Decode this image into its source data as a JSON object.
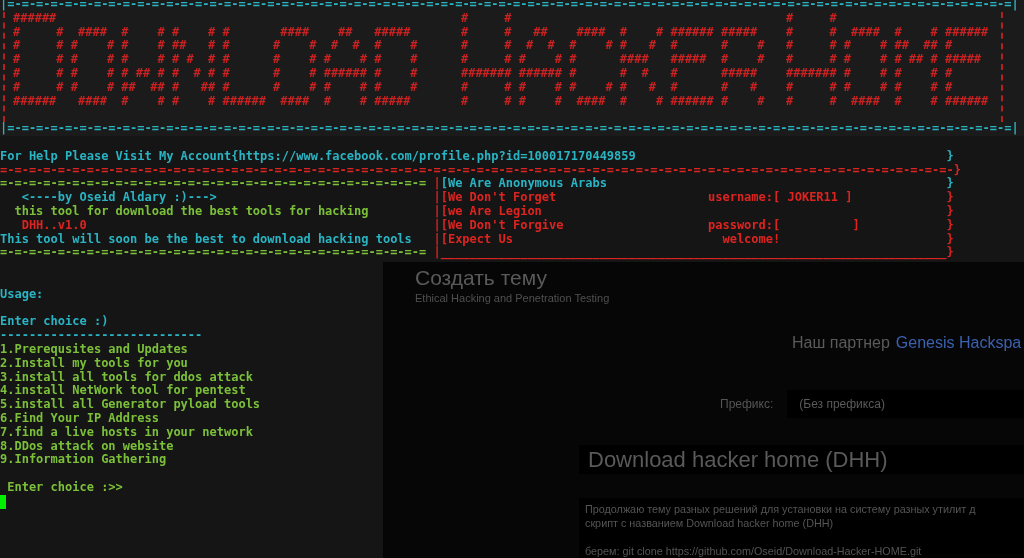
{
  "terminal": {
    "banner": {
      "border_top": "|=-=-=-=-=-=-=-=-=-=-=-=-=-=-=-=-=-=-=-=-=-=-=-=-=-=-=-=-=-=-=-=-=-=-=-=-=-=-=-=-=-=-=-=-=-=-=-=-=-=-=-=-=-=-=-=-=-=-=-=-=-=-=-=-=-=-=-=-=-=|",
      "rows": [
        "######                                                        #     #                                      #     #",
        "#     #  ####  #    # #    # #       ####    ##   #####       #     #   ##    ####  #    # ###### #####    #     #  ####  #    # ######",
        "#     # #    # #    # ##   # #      #    #  #  #  #    #      #     #  #  #  #    # #   #  #      #    #   #     # #    # ##  ## #",
        "#     # #    # #    # # #  # #      #    # #    # #    #      #     # #    # #      ####   #####  #    #   #     # #    # # ## # #####",
        "#     # #    # # ## # #  # # #      #    # ###### #    #      ####### ###### #      #  #   #      #####    ####### #    # #    # #",
        "#     # #    # ##  ## #   ## #      #    # #    # #    #      #     # #    # #    # #   #  #      #   #    #     # #    # #    # #",
        "######   ####  #    # #    # ######  ####  #    # #####       #     # #    #  ####  #    # ###### #    #   #     #  ####  #    # ######"
      ],
      "border_bottom": "|=-=-=-=-=-=-=-=-=-=-=-=-=-=-=-=-=-=-=-=-=-=-=-=-=-=-=-=-=-=-=-=-=-=-=-=-=-=-=-=-=-=-=-=-=-=-=-=-=-=-=-=-=-=-=-=-=-=-=-=-=-=-=-=-=-=-=-=-=-=|"
    },
    "help": {
      "text": "For Help Please Visit My Account{https://www.facebook.com/profile.php?id=100017170449859",
      "end": "}"
    },
    "rule_red": "=-=-=-=-=-=-=-=-=-=-=-=-=-=-=-=-=-=-=-=-=-=-=-=-=-=-=-=-=-=-=-=-=-=-=-=-=-=-=-=-=-=-=-=-=-=-=-=-=-=-=-=-=-=-=-=-=-=-=-=-=-=-=-=-=-=-}",
    "intro": {
      "rule_top": "=-=-=-=-=-=-=-=-=-=-=-=-=-=-=-=-=-=-=-=-=-=-=-=-=-=-=-=-=-=",
      "lines": [
        {
          "text": "   <----by Oseid Aldary :)--->",
          "color": "#2ab4c3"
        },
        {
          "text": "  this tool for download the best tools for hacking",
          "color": "#7cc03a"
        },
        {
          "text": "   DHH..v1.0",
          "color": "#dd2420"
        },
        {
          "text": "This tool will soon be the best to download hacking tools",
          "color": "#2ab4c3"
        }
      ],
      "rule_bottom": "=-=-=-=-=-=-=-=-=-=-=-=-=-=-=-=-=-=-=-=-=-=-=-=-=-=-=-=-=-="
    },
    "slogans": {
      "lines": [
        {
          "bar": "|",
          "text": "[We Are Anonymous Arabs",
          "color": "#2ab4c3",
          "end": "}"
        },
        {
          "bar": "|",
          "text": "[We Don't Forget",
          "field": "username:[ JOKER11 ]",
          "color": "#dd2420",
          "end": "}"
        },
        {
          "bar": "|",
          "text": "[we Are Legion",
          "color": "#dd2420",
          "end": "}"
        },
        {
          "bar": "|",
          "text": "[We Don't Forgive",
          "field": "password:[          ]",
          "color": "#dd2420",
          "end": "}"
        },
        {
          "bar": "|",
          "text": "[Expect Us",
          "field": "  welcome!",
          "color": "#dd2420",
          "end": "}"
        }
      ],
      "footer": "|______________________________________________________________________}"
    },
    "usage": "Usage:",
    "prompt": "Enter choice :)",
    "divider": "----------------------------",
    "menu": [
      "1.Prerequsites and Updates",
      "2.Install my tools for you",
      "3.install all tools for ddos attack",
      "4.install NetWork tool for pentest",
      "5.install all Generator pyload tools",
      "6.Find Your IP Address",
      "7.find a live hosts in your network",
      "8.DDos attack on website",
      "9.Information Gathering"
    ],
    "input_prompt": " Enter choice :>>"
  },
  "browser": {
    "title": "Создать тему",
    "subtitle": "Ethical Hacking and Penetration Testing",
    "partner_label": "Наш партнер",
    "partner_link": "Genesis Hackspa",
    "prefix_label": "Префикс:",
    "prefix_value": "(Без префикса)",
    "topic_title": "Download hacker home (DHH)",
    "message_lines": [
      "Продолжаю тему разных решений для установки на систему разных утилит д",
      "скрипт с названием Download hacker home (DHH)",
      "берем: git clone https://github.com/Oseid/Download-Hacker-HOME.git"
    ]
  }
}
